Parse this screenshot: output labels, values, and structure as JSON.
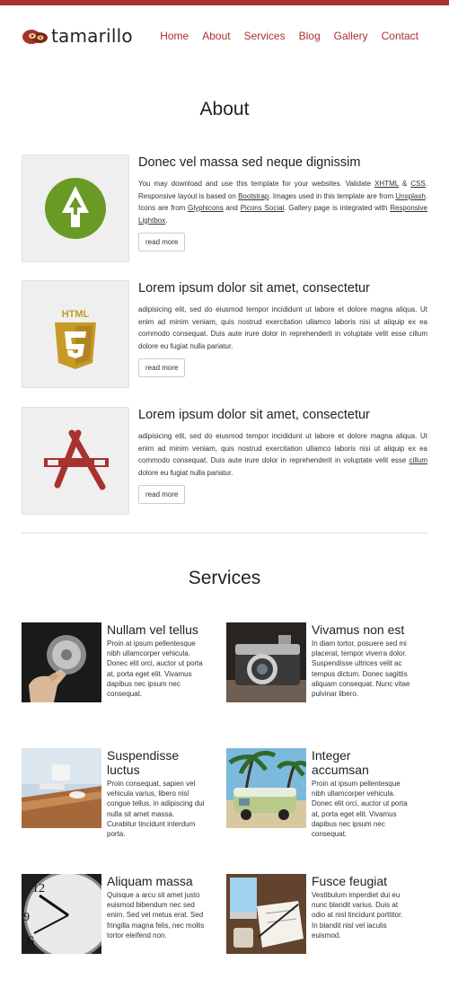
{
  "brand": {
    "name": "tamarillo",
    "accent": "#a83230"
  },
  "nav": [
    {
      "label": "Home"
    },
    {
      "label": "About"
    },
    {
      "label": "Services"
    },
    {
      "label": "Blog"
    },
    {
      "label": "Gallery"
    },
    {
      "label": "Contact"
    }
  ],
  "about": {
    "title": "About",
    "items": [
      {
        "icon": "tree-icon",
        "title": "Donec vel massa sed neque dignissim",
        "text_1": "You may download and use this template for your websites. Validate ",
        "link_xhtml": "XHTML",
        "text_2": " & ",
        "link_css": "CSS",
        "text_3": ". Responsive layout is based on ",
        "link_bootstrap": "Bootstrap",
        "text_4": ". Images used in this template are from ",
        "link_unsplash": "Unsplash",
        "text_5": ". Icons are from ",
        "link_glyphicons": "Glyphicons",
        "text_6": " and ",
        "link_picons": "Picons Social",
        "text_7": ". Gallery page is integrated with ",
        "link_lightbox": "Responsive Lightbox",
        "text_8": ".",
        "button": "read more"
      },
      {
        "icon": "html5-icon",
        "title": "Lorem ipsum dolor sit amet, consectetur",
        "text": "adipisicing elit, sed do eiusmod tempor incididunt ut labore et dolore magna aliqua. Ut enim ad minim veniam, quis nostrud exercitation ullamco laboris nisi ut aliquip ex ea commodo consequat. Duis aute irure dolor in reprehenderit in voluptate velit esse cillum dolore eu fugiat nulla pariatur.",
        "button": "read more"
      },
      {
        "icon": "app-store-icon",
        "title": "Lorem ipsum dolor sit amet, consectetur",
        "text_1": "adipisicing elit, sed do eiusmod tempor incididunt ut labore et dolore magna aliqua. Ut enim ad minim veniam, quis nostrud exercitation ullamco laboris nisi ut aliquip ex ea commodo consequat. Duis aute irure dolor in reprehenderit in voluptate velit esse ",
        "link": "cillum",
        "text_2": " dolore eu fugiat nulla pariatur.",
        "button": "read more"
      }
    ]
  },
  "services": {
    "title": "Services",
    "items": [
      {
        "title": "Nullam vel tellus",
        "text": "Proin at ipsum pellentesque nibh ullamcorper vehicula. Donec elit orci, auctor ut porta at, porta eget elit. Vivamus dapibus nec ipsum nec consequat."
      },
      {
        "title": "Vivamus non est",
        "text": "In diam tortor, posuere sed mi placerat, tempor viverra dolor. Suspendisse ultrices velit ac tempus dictum. Donec sagittis aliquam consequat. Nunc vitae pulvinar libero."
      },
      {
        "title": "Suspendisse luctus",
        "text": "Proin consequat, sapien vel vehicula varius, libero nisl congue tellus, in adipiscing dui nulla sit amet massa. Curabitur tincidunt interdum porta."
      },
      {
        "title": "Integer accumsan",
        "text": "Proin at ipsum pellentesque nibh ullamcorper vehicula. Donec elit orci, auctor ut porta at, porta eget elit. Vivamus dapibus nec ipsum nec consequat."
      },
      {
        "title": "Aliquam massa",
        "text": "Quisque a arcu sit amet justo euismod bibendum nec sed enim. Sed vel metus erat. Sed fringilla magna felis, nec mollis tortor eleifend non."
      },
      {
        "title": "Fusce feugiat",
        "text": "Vestibulum imperdiet dui eu nunc blandit varius. Duis at odio at nisl tincidunt porttitor. In blandit nisl vel iaculis euismod."
      }
    ]
  },
  "colors": {
    "tree": "#6a9a26",
    "html5": "#c79a25",
    "appstore": "#a83230"
  }
}
